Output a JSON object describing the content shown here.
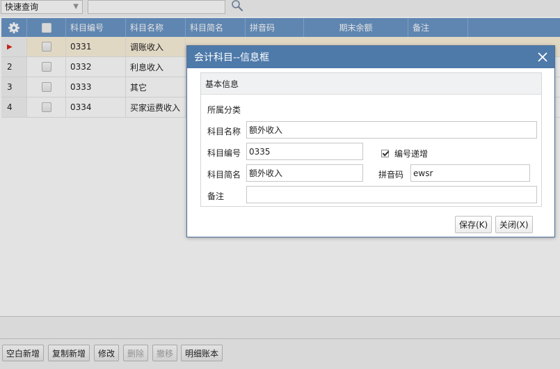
{
  "toolbar": {
    "quick_query": "快速查询",
    "search_value": ""
  },
  "grid": {
    "columns": [
      "科目编号",
      "科目名称",
      "科目简名",
      "拼音码",
      "期末余额",
      "备注"
    ],
    "rows": [
      {
        "num": "",
        "code": "0331",
        "name": "调账收入",
        "selected": true
      },
      {
        "num": "2",
        "code": "0332",
        "name": "利息收入"
      },
      {
        "num": "3",
        "code": "0333",
        "name": "其它"
      },
      {
        "num": "4",
        "code": "0334",
        "name": "买家运费收入"
      }
    ]
  },
  "dialog": {
    "title": "会计科目--信息框",
    "section": "基本信息",
    "category_label": "所属分类",
    "name_label": "科目名称",
    "name_value": "额外收入",
    "code_label": "科目编号",
    "code_value": "0335",
    "auto_increment_label": "编号递增",
    "short_label": "科目简名",
    "short_value": "额外收入",
    "pinyin_label": "拼音码",
    "pinyin_value": "ewsr",
    "note_label": "备注",
    "note_value": "",
    "save_label": "保存(K)",
    "close_label": "关闭(X)"
  },
  "bottom": {
    "buttons": [
      "空白新增",
      "复制新增",
      "修改",
      "删除",
      "撤移",
      "明细账本"
    ]
  },
  "colors": {
    "header_blue": "#6b97c7",
    "dialog_title": "#4e7aaa",
    "selected_row": "#fdf3dd",
    "marker_red": "#d9261c"
  }
}
